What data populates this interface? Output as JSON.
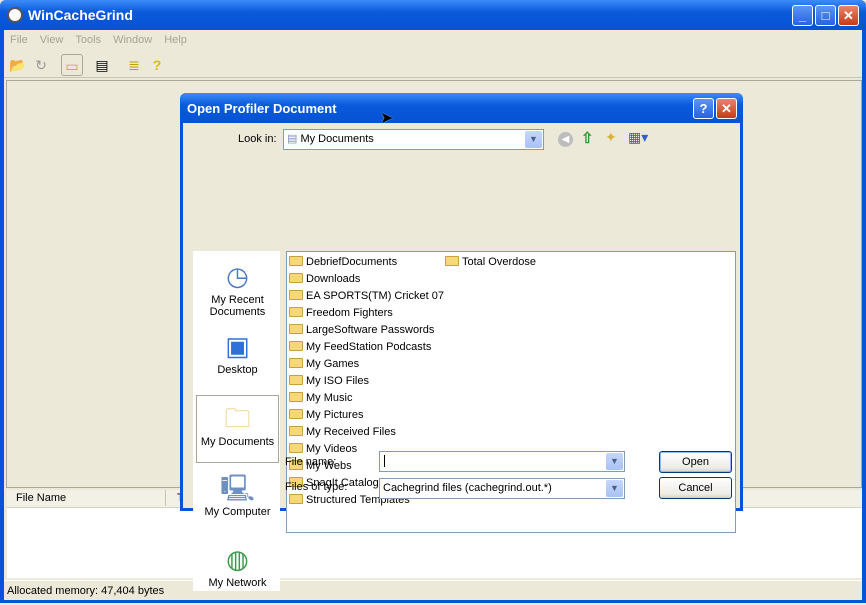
{
  "app": {
    "title": "WinCacheGrind",
    "menu": [
      "File",
      "View",
      "Tools",
      "Window",
      "Help"
    ],
    "toolbar": [
      "open-folder-icon",
      "refresh-icon",
      "folder-icon",
      "properties-icon",
      "function-help-icon",
      "help-icon"
    ],
    "list_header": {
      "col1": "File Name",
      "col2": "T"
    },
    "status": "Allocated memory: 47,404 bytes"
  },
  "dialog": {
    "title": "Open Profiler Document",
    "help": "?",
    "close": "✕",
    "look_in_label": "Look in:",
    "look_in_value": "My Documents",
    "places": [
      "My Recent Documents",
      "Desktop",
      "My Documents",
      "My Computer",
      "My Network"
    ],
    "folders_col1": [
      "DebriefDocuments",
      "Downloads",
      "EA SPORTS(TM) Cricket 07",
      "Freedom Fighters",
      "LargeSoftware Passwords",
      "My FeedStation Podcasts",
      "My Games",
      "My ISO Files",
      "My Music",
      "My Pictures",
      "My Received Files",
      "My Videos",
      "My Webs",
      "SnagIt Catalog",
      "Structured Templates"
    ],
    "folders_col2": [
      "Total Overdose"
    ],
    "file_name_label": "File name:",
    "file_name_value": "",
    "file_type_label": "Files of type:",
    "file_type_value": "Cachegrind files (cachegrind.out.*)",
    "open": "Open",
    "cancel": "Cancel"
  }
}
